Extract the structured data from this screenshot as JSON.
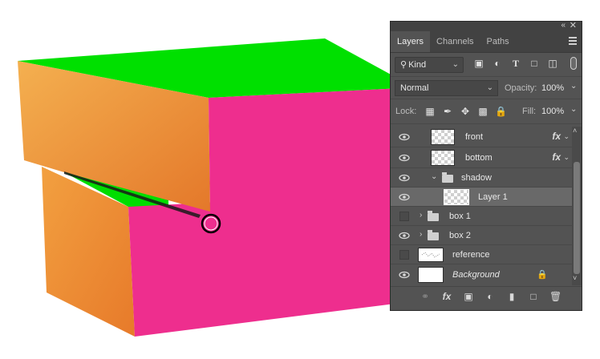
{
  "canvas": {
    "colors": {
      "top": "#00e000",
      "side": "#f08c30",
      "front": "#ee2e8e"
    }
  },
  "panel": {
    "tabs": [
      {
        "label": "Layers",
        "active": true
      },
      {
        "label": "Channels",
        "active": false
      },
      {
        "label": "Paths",
        "active": false
      }
    ],
    "filter": {
      "kind_label": "Kind",
      "icons": [
        "image-filter-icon",
        "adjustment-filter-icon",
        "type-filter-icon",
        "shape-filter-icon",
        "smart-object-filter-icon"
      ]
    },
    "blend": {
      "mode": "Normal",
      "opacity_label": "Opacity:",
      "opacity_value": "100%"
    },
    "lock": {
      "label": "Lock:",
      "fill_label": "Fill:",
      "fill_value": "100%"
    },
    "layers": [
      {
        "name": "front",
        "visible": true,
        "fx": "fx"
      },
      {
        "name": "bottom",
        "visible": true,
        "fx": "fx"
      },
      {
        "name": "shadow",
        "visible": true,
        "type": "group-expanded"
      },
      {
        "name": "Layer 1",
        "visible": true,
        "selected": true
      },
      {
        "name": "box 1",
        "visible": false,
        "type": "group"
      },
      {
        "name": "box 2",
        "visible": true,
        "type": "group"
      },
      {
        "name": "reference",
        "visible": false
      },
      {
        "name": "Background",
        "visible": true,
        "locked": true
      }
    ],
    "bottom_icons": [
      "link-icon",
      "fx-icon",
      "mask-icon",
      "adjustment-icon",
      "new-group-icon",
      "new-layer-icon",
      "trash-icon"
    ]
  }
}
